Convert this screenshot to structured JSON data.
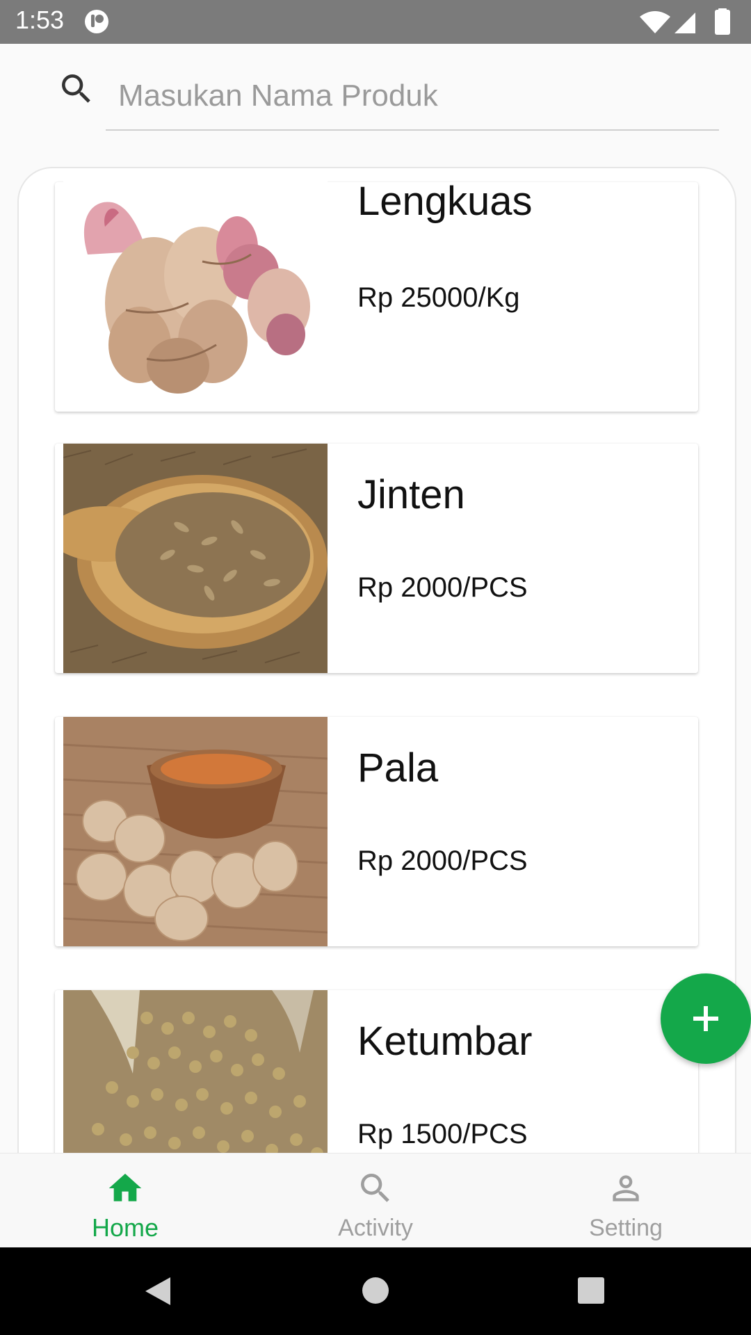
{
  "status_bar": {
    "time": "1:53"
  },
  "search": {
    "placeholder": "Masukan Nama Produk",
    "icon": "search-icon"
  },
  "products": [
    {
      "name": "Lengkuas",
      "price": "Rp 25000/Kg",
      "image": "galangal-photo"
    },
    {
      "name": "Jinten",
      "price": "Rp 2000/PCS",
      "image": "cumin-photo"
    },
    {
      "name": "Pala",
      "price": "Rp 2000/PCS",
      "image": "nutmeg-photo"
    },
    {
      "name": "Ketumbar",
      "price": "Rp 1500/PCS",
      "image": "coriander-photo"
    }
  ],
  "fab": {
    "icon": "plus-icon"
  },
  "bottom_nav": {
    "items": [
      {
        "label": "Home",
        "icon": "home-icon",
        "active": true
      },
      {
        "label": "Activity",
        "icon": "search-icon",
        "active": false
      },
      {
        "label": "Setting",
        "icon": "person-icon",
        "active": false
      }
    ]
  },
  "colors": {
    "accent": "#14a84a",
    "inactive": "#9e9e9e"
  }
}
